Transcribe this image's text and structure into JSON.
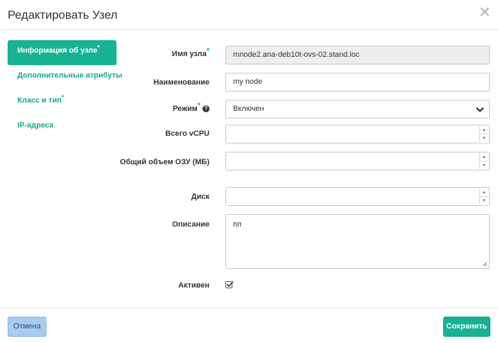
{
  "dialog": {
    "title": "Редактировать Узел",
    "close_glyph": "✕"
  },
  "sidebar": {
    "items": [
      {
        "label": "Информация об узле",
        "required_mark": "*",
        "active": true
      },
      {
        "label": "Дополнительные атрибуты",
        "required_mark": "",
        "active": false
      },
      {
        "label": "Класс и тип",
        "required_mark": "*",
        "active": false
      },
      {
        "label": "IP-адреса",
        "required_mark": "",
        "active": false
      }
    ]
  },
  "form": {
    "node_name": {
      "label": "Имя узла",
      "required_mark": "*",
      "value": "mnode2.ana-deb10t-ovs-02.stand.loc",
      "readonly": true
    },
    "display_name": {
      "label": "Наименование",
      "value": "my node"
    },
    "mode": {
      "label": "Режим",
      "required_mark": "*",
      "help_glyph": "?",
      "selected": "Включен"
    },
    "vcpu": {
      "label": "Всего vCPU",
      "value": ""
    },
    "ram": {
      "label": "Общий объем ОЗУ (МБ)",
      "value": ""
    },
    "disk": {
      "label": "Диск",
      "value": ""
    },
    "description": {
      "label": "Описание",
      "value": "пп"
    },
    "active": {
      "label": "Активен",
      "checked": true
    }
  },
  "spinner": {
    "up_glyph": "▲",
    "down_glyph": "▼"
  },
  "footer": {
    "cancel_label": "Отмена",
    "save_label": "Сохранить"
  },
  "colors": {
    "accent": "#16b393",
    "cancel_bg": "#a8cbf0"
  }
}
